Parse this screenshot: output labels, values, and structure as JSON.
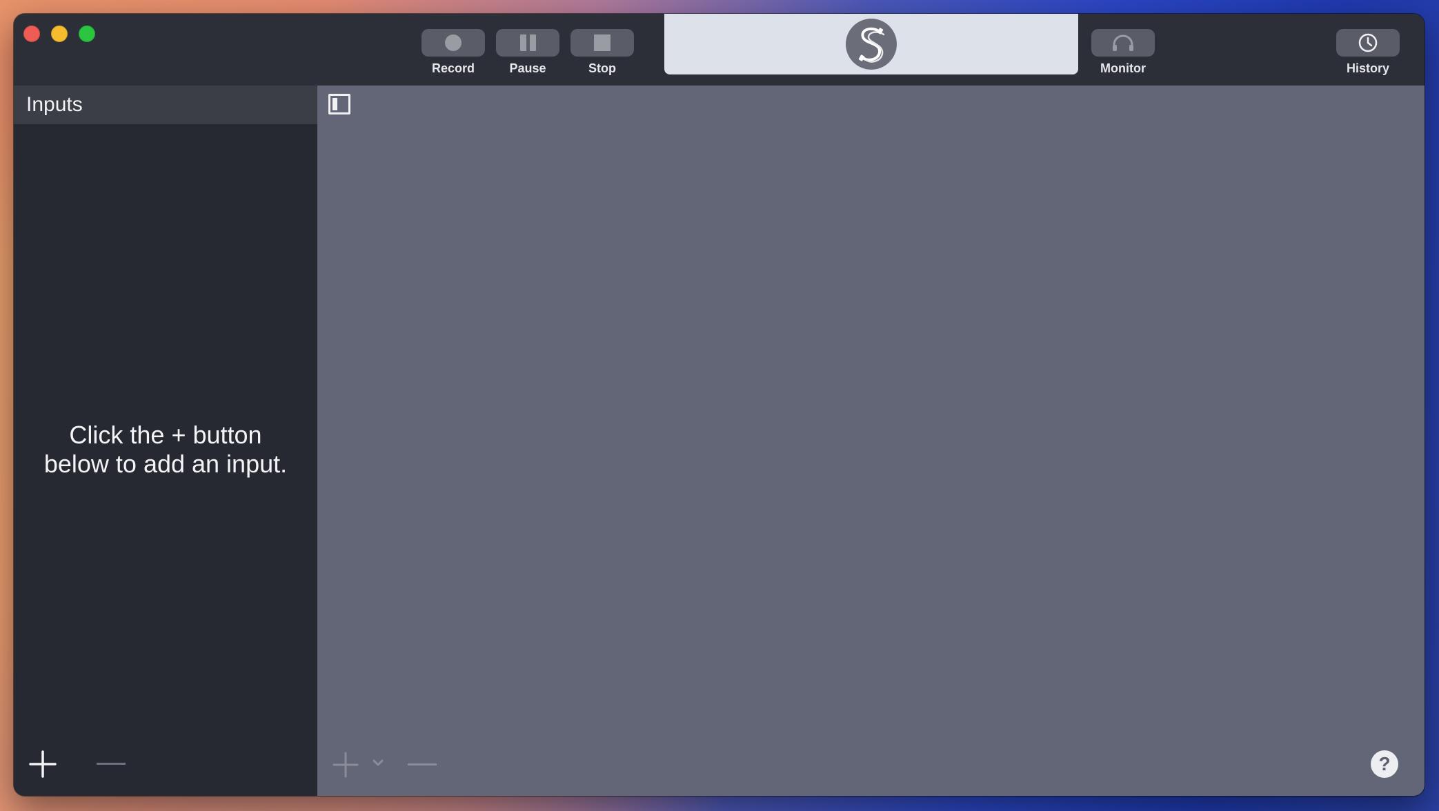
{
  "window": {
    "title": ""
  },
  "toolbar": {
    "record_label": "Record",
    "pause_label": "Pause",
    "stop_label": "Stop",
    "monitor_label": "Monitor",
    "history_label": "History",
    "logo_icon": "s-cable-logo-icon"
  },
  "sidebar": {
    "title": "Inputs",
    "empty_line1": "Click the + button",
    "empty_line2": "below to add an input.",
    "add_icon": "plus-icon",
    "remove_icon": "minus-icon"
  },
  "main": {
    "toggle_icon": "sidebar-toggle-icon",
    "add_icon": "plus-icon",
    "add_menu_icon": "chevron-down-icon",
    "remove_icon": "minus-icon",
    "help_label": "?"
  },
  "colors": {
    "titlebar": "#2c2e38",
    "sidebar": "#262832",
    "main": "#636676",
    "logo_panel": "#dde2ea"
  }
}
